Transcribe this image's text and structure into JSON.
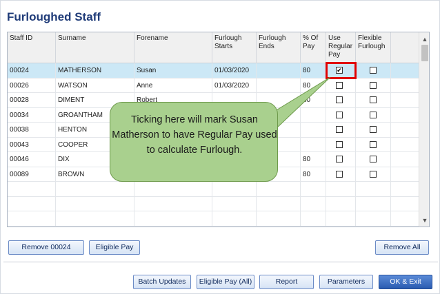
{
  "title": "Furloughed Staff",
  "columns": [
    "Staff ID",
    "Surname",
    "Forename",
    "Furlough Starts",
    "Furlough Ends",
    "% Of Pay",
    "Use Regular Pay",
    "Flexible Furlough"
  ],
  "rows": [
    {
      "id": "00024",
      "surname": "MATHERSON",
      "forename": "Susan",
      "starts": "01/03/2020",
      "ends": "",
      "pay": "80",
      "regular": true,
      "flexible": false,
      "selected": true
    },
    {
      "id": "00026",
      "surname": "WATSON",
      "forename": "Anne",
      "starts": "01/03/2020",
      "ends": "",
      "pay": "80",
      "regular": false,
      "flexible": false,
      "selected": false
    },
    {
      "id": "00028",
      "surname": "DIMENT",
      "forename": "Robert",
      "starts": "",
      "ends": "",
      "pay": "80",
      "regular": false,
      "flexible": false,
      "selected": false
    },
    {
      "id": "00034",
      "surname": "GROANTHAM",
      "forename": "",
      "starts": "",
      "ends": "",
      "pay": "",
      "regular": false,
      "flexible": false,
      "selected": false
    },
    {
      "id": "00038",
      "surname": "HENTON",
      "forename": "",
      "starts": "",
      "ends": "",
      "pay": "",
      "regular": false,
      "flexible": false,
      "selected": false
    },
    {
      "id": "00043",
      "surname": "COOPER",
      "forename": "",
      "starts": "",
      "ends": "",
      "pay": "",
      "regular": false,
      "flexible": false,
      "selected": false
    },
    {
      "id": "00046",
      "surname": "DIX",
      "forename": "",
      "starts": "",
      "ends": "",
      "pay": "80",
      "regular": false,
      "flexible": false,
      "selected": false
    },
    {
      "id": "00089",
      "surname": "BROWN",
      "forename": "",
      "starts": "",
      "ends": "",
      "pay": "80",
      "regular": false,
      "flexible": false,
      "selected": false
    }
  ],
  "empty_rows": 3,
  "callout": "Ticking here will mark Susan Matherson to have Regular Pay used to calculate Furlough.",
  "buttons": {
    "remove": "Remove 00024",
    "eligible_pay": "Eligible Pay",
    "remove_all": "Remove All",
    "batch_updates": "Batch Updates",
    "eligible_pay_all": "Eligible Pay (All)",
    "report": "Report",
    "parameters": "Parameters",
    "ok_exit": "OK & Exit"
  },
  "scroll": {
    "up": "▲",
    "down": "▼"
  },
  "colors": {
    "selected_row": "#cce8f6",
    "highlight": "#e10000",
    "callout": "#a9d08e",
    "title": "#1f3b78"
  }
}
